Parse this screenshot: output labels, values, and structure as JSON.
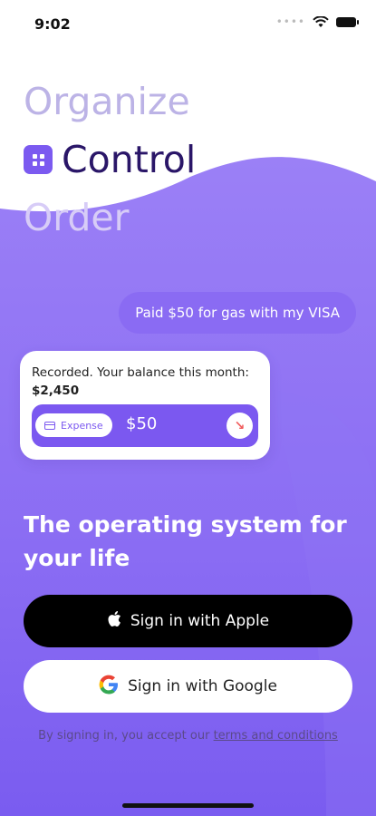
{
  "status_bar": {
    "time": "9:02"
  },
  "hero": {
    "words": [
      "Organize",
      "Control",
      "Order"
    ]
  },
  "chat": {
    "user_message": "Paid $50 for gas with my VISA",
    "reply_prefix": "Recorded. Your balance this month: ",
    "reply_balance": "$2,450",
    "expense_tag": "Expense",
    "expense_amount": "$50"
  },
  "tagline": "The operating system for your life",
  "buttons": {
    "apple": "Sign in with Apple",
    "google": "Sign in with Google"
  },
  "legal": {
    "prefix": "By signing in, you accept our ",
    "link": "terms and conditions"
  },
  "colors": {
    "accent": "#7b58f0",
    "gradient_top": "#9a7ef6",
    "gradient_bottom": "#7a5cf0",
    "hero_active": "#2a1668",
    "hero_faded": "#bcb3e6"
  },
  "icons": {
    "wifi": "wifi-icon",
    "battery": "battery-icon",
    "app": "app-logo-icon",
    "apple": "apple-icon",
    "google": "google-icon",
    "card": "card-icon",
    "arrow": "arrow-down-right-icon"
  }
}
